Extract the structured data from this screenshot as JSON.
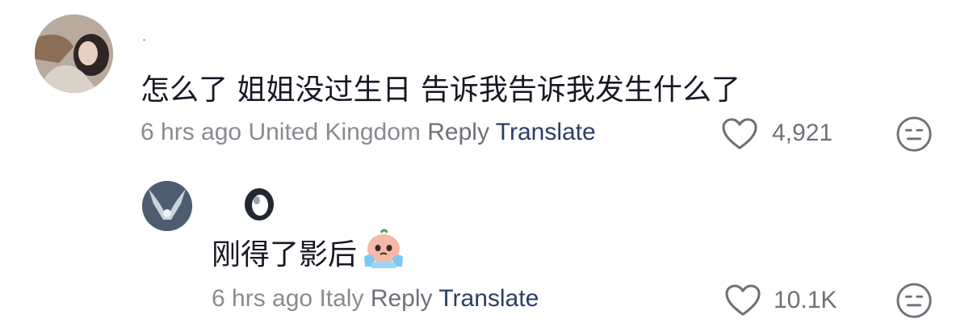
{
  "comment1": {
    "text": "怎么了 姐姐没过生日 告诉我告诉我发生什么了",
    "time": "6 hrs ago",
    "location": "United Kingdom",
    "reply_label": "Reply",
    "translate_label": "Translate",
    "likes": "4,921"
  },
  "comment2": {
    "text": "刚得了影后",
    "time": "6 hrs ago",
    "location": "Italy",
    "reply_label": "Reply",
    "translate_label": "Translate",
    "likes": "10.1K"
  },
  "icons": {
    "like": "heart-icon",
    "dislike": "neutral-face-icon",
    "emoji": "crying-face-emoji"
  },
  "colors": {
    "text": "#161823",
    "meta": "#8a8b91",
    "translate": "#2c3e66"
  }
}
